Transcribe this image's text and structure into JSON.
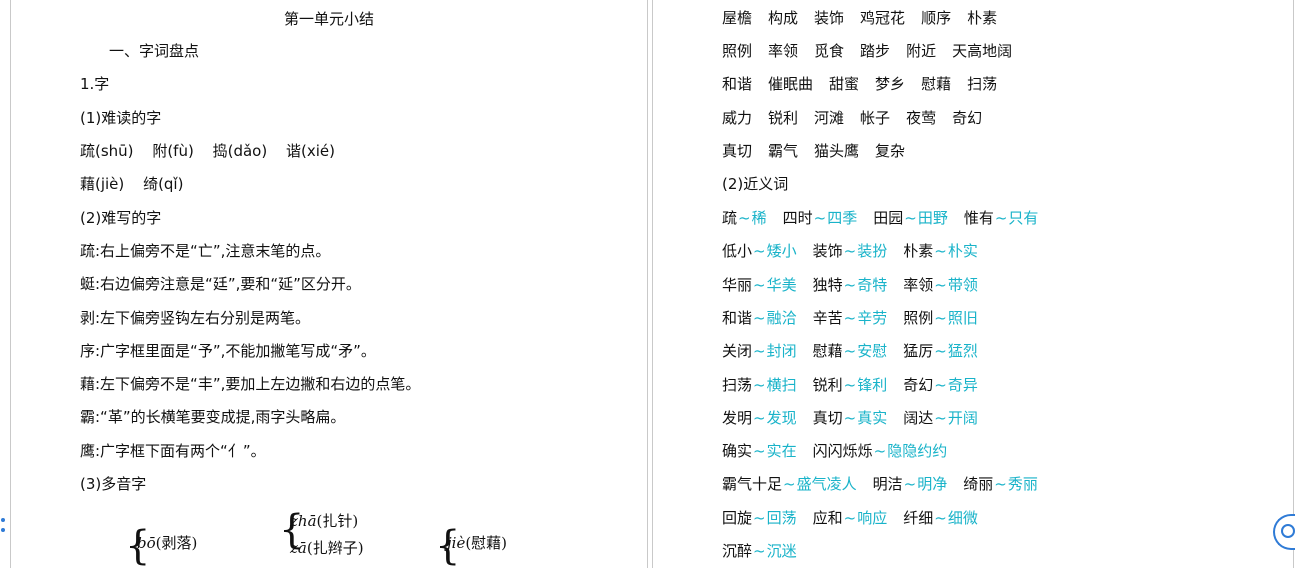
{
  "left_page": {
    "title": "第一单元小结",
    "section_heading": "一、字词盘点",
    "sub1": "1.字",
    "hard_read_heading": "(1)难读的字",
    "hard_read_line1": [
      "疏(shū)",
      "附(fù)",
      "捣(dǎo)",
      "谐(xié)"
    ],
    "hard_read_line2": [
      "藉(jiè)",
      "绮(qǐ)"
    ],
    "hard_write_heading": "(2)难写的字",
    "hard_write_items": [
      "疏:右上偏旁不是“亡”,注意末笔的点。",
      "蜓:右边偏旁注意是“廷”,要和“延”区分开。",
      "剥:左下偏旁竖钩左右分别是两笔。",
      "序:广字框里面是“予”,不能加撇笔写成“矛”。",
      "藉:左下偏旁不是“丰”,要加上左边撇和右边的点笔。",
      "霸:“革”的长横笔要变成提,雨字头略扁。",
      "鹰:广字框下面有两个“亻”。"
    ],
    "polyphone_heading": "(3)多音字",
    "polyphones": {
      "bo": {
        "pinyin": "bō",
        "example": "(剥落)"
      },
      "zha": {
        "pinyin": "zhā",
        "example": "(扎针)"
      },
      "za": {
        "pinyin": "zā",
        "example": "(扎辫子)"
      },
      "jie": {
        "pinyin": "jiè",
        "example": "(慰藉)"
      }
    }
  },
  "right_page": {
    "word_rows": [
      [
        "屋檐",
        "构成",
        "装饰",
        "鸡冠花",
        "顺序",
        "朴素"
      ],
      [
        "照例",
        "率领",
        "觅食",
        "踏步",
        "附近",
        "天高地阔"
      ],
      [
        "和谐",
        "催眠曲",
        "甜蜜",
        "梦乡",
        "慰藉",
        "扫荡"
      ],
      [
        "威力",
        "锐利",
        "河滩",
        "帐子",
        "夜莺",
        "奇幻"
      ],
      [
        "真切",
        "霸气",
        "猫头鹰",
        "复杂"
      ]
    ],
    "synonym_heading": "(2)近义词",
    "synonym_rows": [
      [
        [
          "疏",
          "稀"
        ],
        [
          "四时",
          "四季"
        ],
        [
          "田园",
          "田野"
        ],
        [
          "惟有",
          "只有"
        ]
      ],
      [
        [
          "低小",
          "矮小"
        ],
        [
          "装饰",
          "装扮"
        ],
        [
          "朴素",
          "朴实"
        ]
      ],
      [
        [
          "华丽",
          "华美"
        ],
        [
          "独特",
          "奇特"
        ],
        [
          "率领",
          "带领"
        ]
      ],
      [
        [
          "和谐",
          "融洽"
        ],
        [
          "辛苦",
          "辛劳"
        ],
        [
          "照例",
          "照旧"
        ]
      ],
      [
        [
          "关闭",
          "封闭"
        ],
        [
          "慰藉",
          "安慰"
        ],
        [
          "猛厉",
          "猛烈"
        ]
      ],
      [
        [
          "扫荡",
          "横扫"
        ],
        [
          "锐利",
          "锋利"
        ],
        [
          "奇幻",
          "奇异"
        ]
      ],
      [
        [
          "发明",
          "发现"
        ],
        [
          "真切",
          "真实"
        ],
        [
          "阔达",
          "开阔"
        ]
      ],
      [
        [
          "确实",
          "实在"
        ],
        [
          "闪闪烁烁",
          "隐隐约约"
        ]
      ],
      [
        [
          "霸气十足",
          "盛气凌人"
        ],
        [
          "明洁",
          "明净"
        ],
        [
          "绮丽",
          "秀丽"
        ]
      ],
      [
        [
          "回旋",
          "回荡"
        ],
        [
          "应和",
          "响应"
        ],
        [
          "纤细",
          "细微"
        ]
      ],
      [
        [
          "沉醉",
          "沉迷"
        ]
      ]
    ],
    "tilde": "~"
  },
  "colors": {
    "accent": "#19b3c9",
    "widget": "#2f7bd6",
    "border": "#c9c9c9"
  },
  "icons": {
    "side_widget": "assistant-face-icon"
  }
}
